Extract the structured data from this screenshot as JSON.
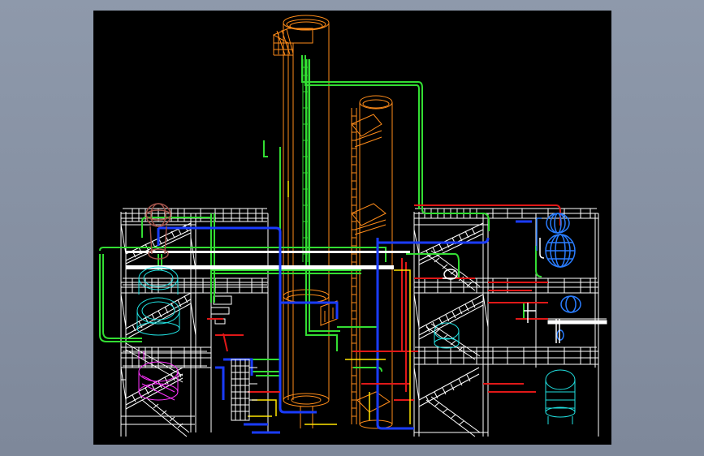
{
  "window": {
    "background": "#8a95a7"
  },
  "drawing": {
    "background": "#000000",
    "label_text": "",
    "layer_colors": {
      "structure": "#ffffff",
      "column": "#ff8c1a",
      "pipe_green": "#33dd33",
      "pipe_blue": "#1a3cff",
      "pipe_red": "#e01818",
      "pipe_yellow": "#ffe600",
      "vessel_cyan": "#20e0e0",
      "vessel_blue": "#2a7dff",
      "vessel_magenta": "#ff33ff",
      "vessel_brown": "#a0524a"
    },
    "components": [
      "left-steel-frame",
      "right-steel-frame",
      "tall-column",
      "middle-column",
      "short-column",
      "green-pipe-rack",
      "blue-pipe-loop",
      "left-stairs",
      "right-stairs",
      "heat-exchanger",
      "cyan-drums",
      "blue-reactor",
      "magenta-vessel",
      "brown-vessel"
    ]
  }
}
